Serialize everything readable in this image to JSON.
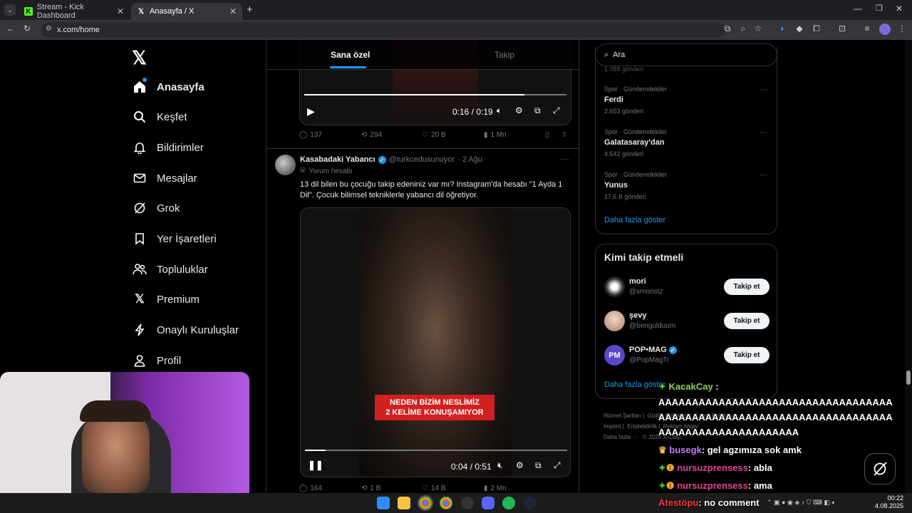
{
  "browser": {
    "tabs": [
      {
        "title": "Stream - Kick Dashboard",
        "icon": "kick-icon",
        "active": false
      },
      {
        "title": "Anasayfa / X",
        "icon": "x-logo-icon",
        "active": true
      }
    ],
    "url": "x.com/home"
  },
  "sidebar": {
    "items": [
      {
        "label": "Anasayfa",
        "icon": "home-icon"
      },
      {
        "label": "Keşfet",
        "icon": "search-icon"
      },
      {
        "label": "Bildirimler",
        "icon": "bell-icon"
      },
      {
        "label": "Mesajlar",
        "icon": "mail-icon"
      },
      {
        "label": "Grok",
        "icon": "grok-icon"
      },
      {
        "label": "Yer İşaretleri",
        "icon": "bookmark-icon"
      },
      {
        "label": "Topluluklar",
        "icon": "communities-icon"
      },
      {
        "label": "Premium",
        "icon": "x-logo-icon"
      },
      {
        "label": "Onaylı Kuruluşlar",
        "icon": "lightning-icon"
      },
      {
        "label": "Profil",
        "icon": "person-icon"
      }
    ]
  },
  "feed": {
    "tabs": [
      "Sana özel",
      "Takip"
    ],
    "post1": {
      "time": "0:16 / 0:19",
      "replies": "137",
      "reposts": "294",
      "likes": "20 B",
      "views": "1 Mn",
      "progress": 0.84
    },
    "post2": {
      "name": "Kasabadaki Yabancı",
      "handle": "@turkcedusunuyor",
      "date": "· 2 Ağu",
      "badge": "Yorum hesabı",
      "text1": "13 dil bilen bu çocuğu takip edeniniz var mı? Instagram'da hesabı \"1 Ayda 1",
      "text2": "Dil\". Çocuk bilimsel tekniklerle yabancı dil öğretiyor.",
      "caption1": "NEDEN BİZİM NESLİMİZ",
      "caption2": "2 KELİME KONUŞAMIYOR",
      "time": "0:04 / 0:51",
      "progress": 0.08,
      "replies": "164",
      "reposts": "1 B",
      "likes": "14 B",
      "views": "2 Mn"
    }
  },
  "right": {
    "search_placeholder": "Ara",
    "trends_top_count": "1.088 gönderi",
    "trends": [
      {
        "category": "Spor · Gündemdekiler",
        "name": "Ferdi",
        "count": "2.653 gönderi"
      },
      {
        "category": "Spor · Gündemdekiler",
        "name": "Galatasaray'dan",
        "count": "4.542 gönderi"
      },
      {
        "category": "Spor · Gündemdekiler",
        "name": "Yunus",
        "count": "17,6 B gönderi"
      }
    ],
    "show_more": "Daha fazla göster",
    "who_to_follow_title": "Kimi takip etmeli",
    "who_to_follow": [
      {
        "name": "mori",
        "handle": "@smoristz",
        "button": "Takip et"
      },
      {
        "name": "şevy",
        "handle": "@bengulduum",
        "button": "Takip et"
      },
      {
        "name": "POP•MAG",
        "handle": "@PopMagTr",
        "button": "Takip et"
      }
    ],
    "show_more_2": "Daha fazla göster",
    "footer": [
      "Hizmet Şartları",
      "Gizlilik Politikası",
      "Çerez Politikası",
      "Imprint",
      "Erişilebilirlik",
      "Reklam bilgisi",
      "Daha fazla ···",
      "© 2025 X Corp."
    ]
  },
  "chat": [
    {
      "user": "KacakCay",
      "message": " :",
      "color": "#8bd35a"
    },
    {
      "user": "",
      "message": "AAAAAAAAAAAAAAAAAAAAAAAAAAAAAAAAAAA"
    },
    {
      "user": "",
      "message": "AAAAAAAAAAAAAAAAAAAAAAAAAAAAAAAAAAA"
    },
    {
      "user": "",
      "message": "AAAAAAAAAAAAAAAAAAAAA"
    },
    {
      "user": "busegk",
      "message": ": gel agzımıza sok amk",
      "color": "#c47cf7"
    },
    {
      "user": "nursuzprensess",
      "message": ": abla",
      "color": "#e0449a"
    },
    {
      "user": "nursuzprensess",
      "message": ": ama",
      "color": "#e0449a"
    },
    {
      "user": "Atestöpu",
      "message": ": no comment",
      "color": "#ff3b3b"
    }
  ],
  "clock": {
    "time": "00:22",
    "date": "4.08.2025"
  }
}
